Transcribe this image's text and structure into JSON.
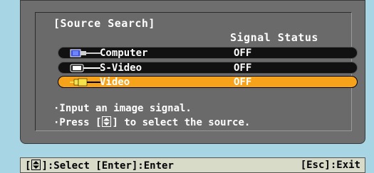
{
  "osd": {
    "title": "[Source Search]",
    "column_header": "Signal Status",
    "sources": [
      {
        "name": "Computer",
        "status": "OFF",
        "icon": "computer-vga-connector-icon",
        "selected": false
      },
      {
        "name": "S-Video",
        "status": "OFF",
        "icon": "s-video-connector-icon",
        "selected": false
      },
      {
        "name": "Video",
        "status": "OFF",
        "icon": "rca-video-connector-icon",
        "selected": true
      }
    ],
    "message_1": "·Input an image signal.",
    "message_2_prefix": "·Press [",
    "message_2_suffix": "] to select the source.",
    "selection_color": "#f6a21a"
  },
  "footer": {
    "left_prefix": "[",
    "left_suffix": "]:Select [Enter]:Enter",
    "right": "[Esc]:Exit"
  }
}
